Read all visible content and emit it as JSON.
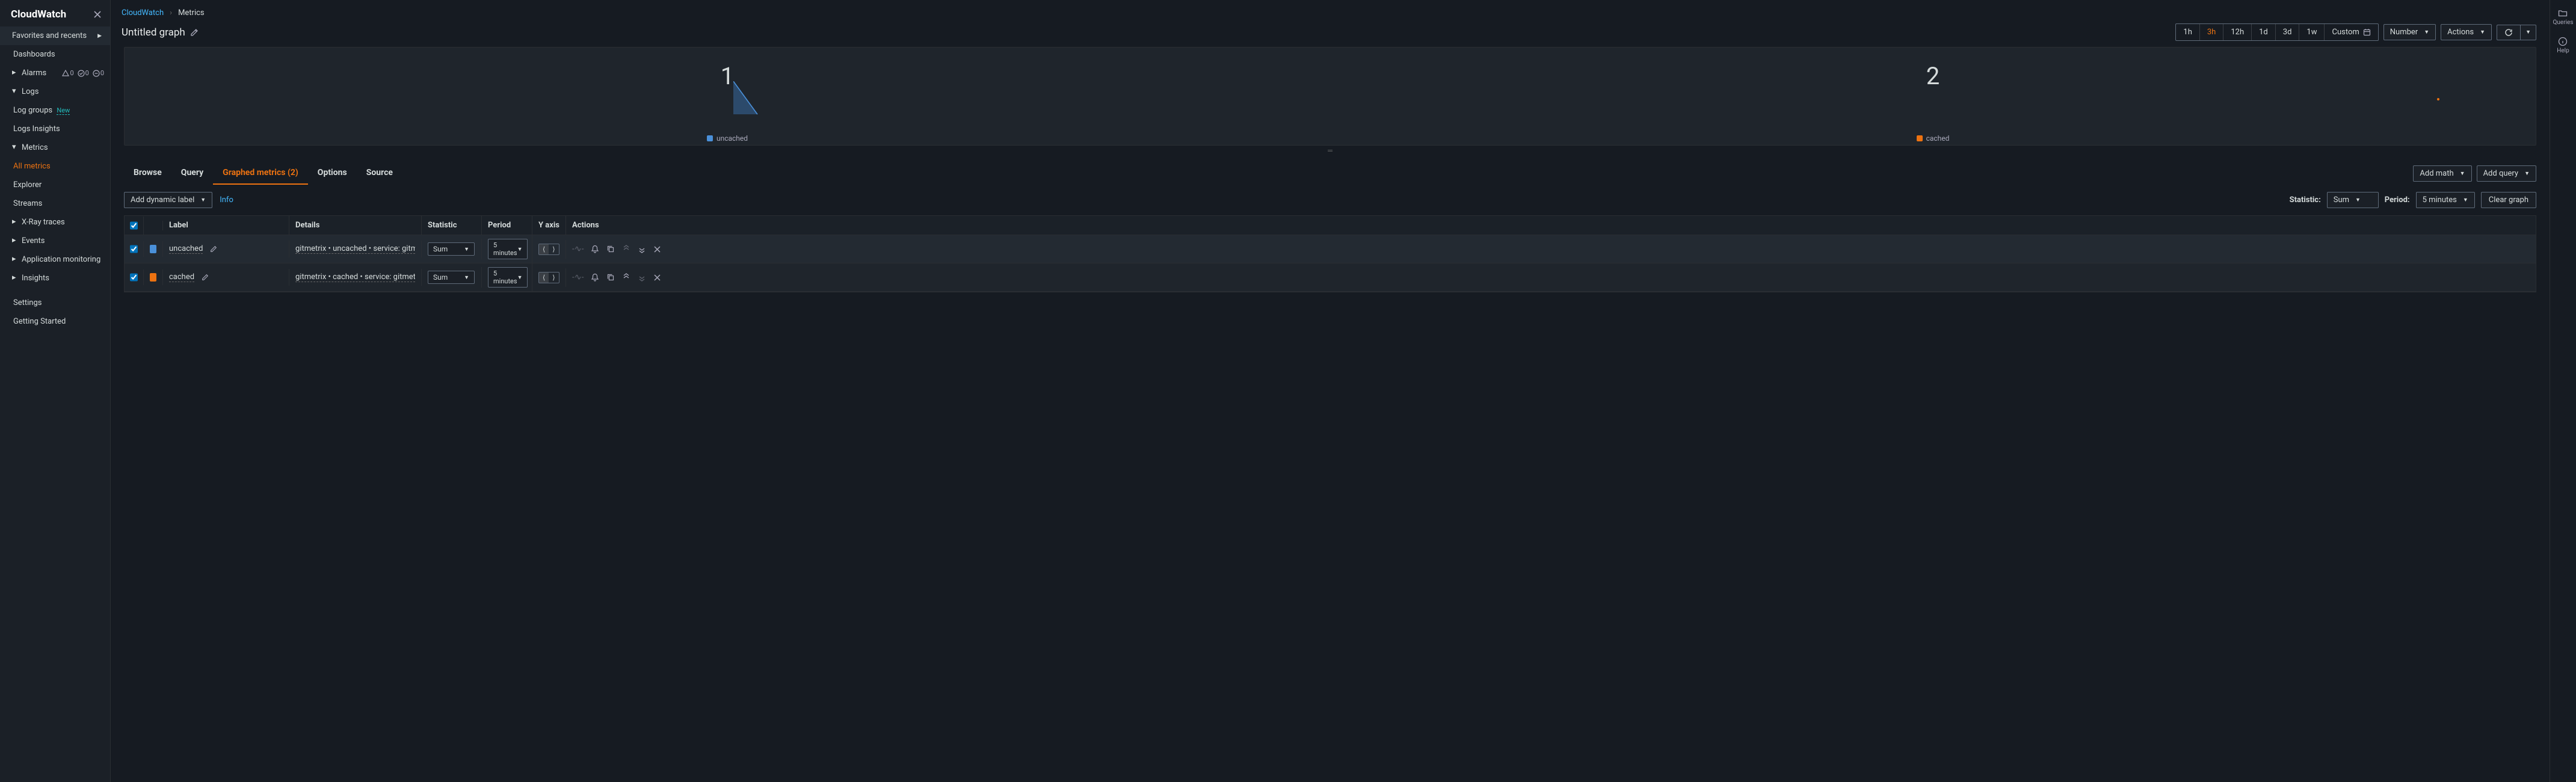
{
  "sidebar": {
    "title": "CloudWatch",
    "favorites": "Favorites and recents",
    "dashboards": "Dashboards",
    "alarms": {
      "label": "Alarms",
      "c1": "0",
      "c2": "0",
      "c3": "0"
    },
    "logs": {
      "label": "Logs",
      "groups": "Log groups",
      "groups_badge": "New",
      "insights": "Logs Insights"
    },
    "metrics": {
      "label": "Metrics",
      "all": "All metrics",
      "explorer": "Explorer",
      "streams": "Streams"
    },
    "xray": "X-Ray traces",
    "events": "Events",
    "appmon": "Application monitoring",
    "insights": "Insights",
    "settings": "Settings",
    "getting_started": "Getting Started"
  },
  "breadcrumb": {
    "root": "CloudWatch",
    "current": "Metrics"
  },
  "title": "Untitled graph",
  "range": {
    "h1": "1h",
    "h3": "3h",
    "h12": "12h",
    "d1": "1d",
    "d3": "3d",
    "w1": "1w",
    "custom": "Custom"
  },
  "vis_dd": "Number",
  "actions_dd": "Actions",
  "panels": {
    "v1": "1",
    "v2": "2",
    "l1": "uncached",
    "l2": "cached"
  },
  "tabs": {
    "browse": "Browse",
    "query": "Query",
    "graphed": "Graphed metrics (2)",
    "options": "Options",
    "source": "Source"
  },
  "tab_actions": {
    "math": "Add math",
    "query": "Add query"
  },
  "toolbar": {
    "add_dyn": "Add dynamic label",
    "info": "Info",
    "stat_lbl": "Statistic:",
    "stat_val": "Sum",
    "period_lbl": "Period:",
    "period_val": "5 minutes",
    "clear": "Clear graph"
  },
  "thead": {
    "label": "Label",
    "details": "Details",
    "statistic": "Statistic",
    "period": "Period",
    "yaxis": "Y axis",
    "actions": "Actions"
  },
  "rows": [
    {
      "color": "#4a90d9",
      "label": "uncached",
      "details": "gitmetrix • uncached • service: gitmetrix • Cac",
      "stat": "Sum",
      "period": "5 minutes"
    },
    {
      "color": "#ec7211",
      "label": "cached",
      "details": "gitmetrix • cached • service: gitmetrix • Cache",
      "stat": "Sum",
      "period": "5 minutes"
    }
  ],
  "rside": {
    "queries": "Queries",
    "help": "Help"
  },
  "chart_data": {
    "type": "number",
    "series": [
      {
        "name": "uncached",
        "value": 1,
        "color": "#4a90d9"
      },
      {
        "name": "cached",
        "value": 2,
        "color": "#ec7211"
      }
    ]
  }
}
